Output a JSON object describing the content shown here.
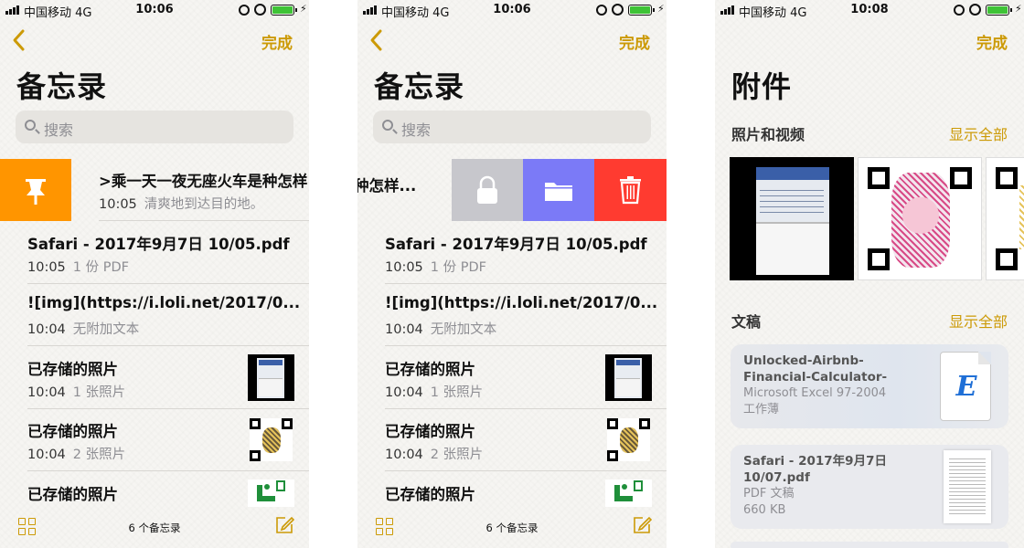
{
  "colors": {
    "accent": "#cc9a06",
    "pin": "#ff9500",
    "lock": "#c7c7cc",
    "folder": "#7b7af7",
    "delete": "#ff3b30",
    "battery": "#3ec336"
  },
  "status_bar": {
    "carrier": "中国移动  4G",
    "battery_icon": "battery-icon",
    "charging_icon": "bolt-icon"
  },
  "screen1": {
    "time": "10:06",
    "done": "完成",
    "title": "备忘录",
    "search_placeholder": "搜索",
    "pinned_note": {
      "title": ">乘一天一夜无座火车是种怎样...",
      "time": "10:05",
      "desc": "清爽地到达目的地。"
    },
    "notes": [
      {
        "title": "Safari - 2017年9月7日 10/05.pdf",
        "time": "10:05",
        "desc": "1 份 PDF"
      },
      {
        "title": "![img](https://i.loli.net/2017/0...",
        "time": "10:04",
        "desc": "无附加文本"
      },
      {
        "title": "已存储的照片",
        "time": "10:04",
        "desc": "1 张照片"
      },
      {
        "title": "已存储的照片",
        "time": "10:04",
        "desc": "2 张照片"
      },
      {
        "title": "已存储的照片",
        "time": "",
        "desc": ""
      }
    ],
    "note_count": "6 个备忘录"
  },
  "screen2": {
    "time": "10:06",
    "done": "完成",
    "title": "备忘录",
    "search_placeholder": "搜索",
    "swiped_note_title_tail": "种怎样...",
    "notes": [
      {
        "title": "Safari - 2017年9月7日 10/05.pdf",
        "time": "10:05",
        "desc": "1 份 PDF"
      },
      {
        "title": "![img](https://i.loli.net/2017/0...",
        "time": "10:04",
        "desc": "无附加文本"
      },
      {
        "title": "已存储的照片",
        "time": "10:04",
        "desc": "1 张照片"
      },
      {
        "title": "已存储的照片",
        "time": "10:04",
        "desc": "2 张照片"
      },
      {
        "title": "已存储的照片",
        "time": "",
        "desc": ""
      }
    ],
    "note_count": "6 个备忘录"
  },
  "screen3": {
    "time": "10:08",
    "done": "完成",
    "title": "附件",
    "photos_section": "照片和视频",
    "photos_show_all": "显示全部",
    "docs_section": "文稿",
    "docs_show_all": "显示全部",
    "documents": [
      {
        "name": "Unlocked-Airbnb-Financial-Calculator-",
        "type": "Microsoft Excel 97-2004",
        "type2": "工作薄",
        "icon_letter": "E"
      },
      {
        "name": "Safari - 2017年9月7日 10/07.pdf",
        "type": "PDF 文稿",
        "size": "660 KB"
      }
    ]
  }
}
